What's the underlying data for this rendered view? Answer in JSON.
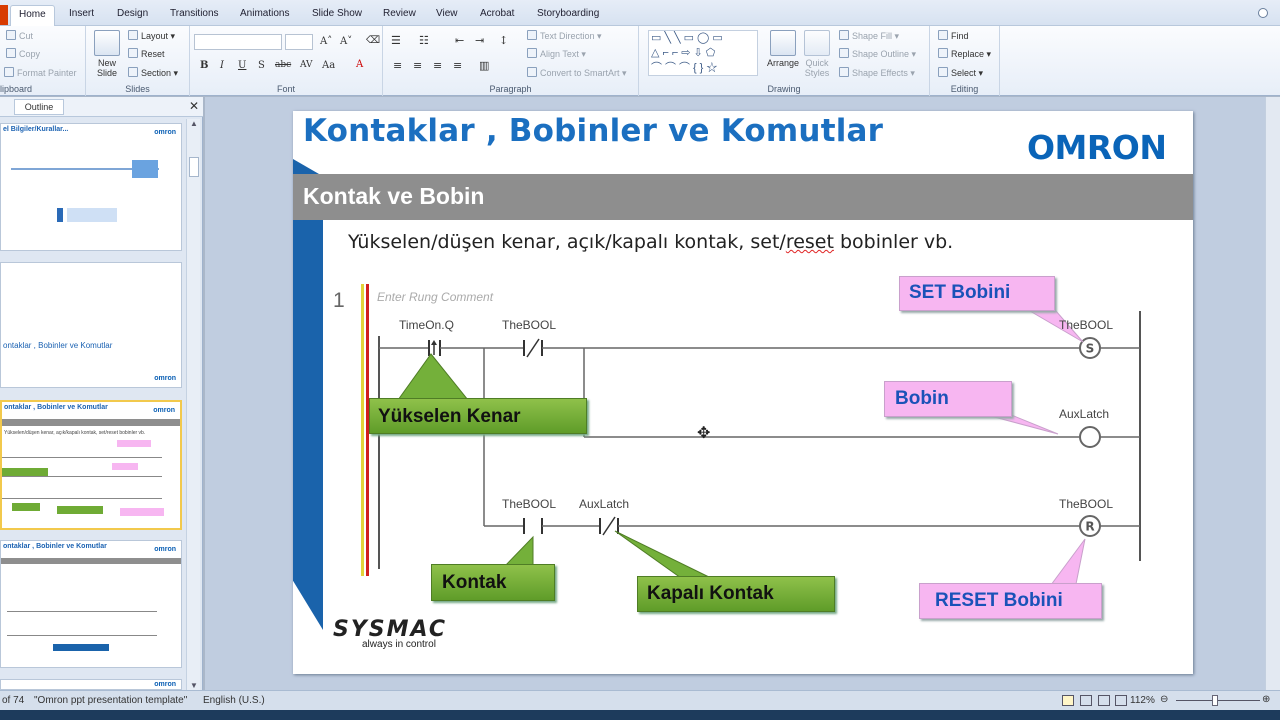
{
  "ribbon": {
    "tabs": [
      "Home",
      "Insert",
      "Design",
      "Transitions",
      "Animations",
      "Slide Show",
      "Review",
      "View",
      "Acrobat",
      "Storyboarding"
    ],
    "active_tab": "Home",
    "clipboard": {
      "cut": "Cut",
      "copy": "Copy",
      "format_painter": "Format Painter",
      "label": "lipboard"
    },
    "slides": {
      "new_slide": "New Slide",
      "layout": "Layout",
      "reset": "Reset",
      "section": "Section",
      "label": "Slides"
    },
    "font": {
      "label": "Font"
    },
    "paragraph": {
      "text_direction": "Text Direction",
      "align_text": "Align Text",
      "convert": "Convert to SmartArt",
      "label": "Paragraph"
    },
    "drawing": {
      "arrange": "Arrange",
      "quick_styles": "Quick Styles",
      "shape_fill": "Shape Fill",
      "shape_outline": "Shape Outline",
      "shape_effects": "Shape Effects",
      "label": "Drawing"
    },
    "editing": {
      "find": "Find",
      "replace": "Replace",
      "select": "Select",
      "label": "Editing"
    }
  },
  "left_panel": {
    "outline_tab": "Outline",
    "thumbs": [
      {
        "title": "el Bilgiler/Kurallar...",
        "logo": "omron"
      },
      {
        "title": "ontaklar ,  Bobinler ve Komutlar",
        "logo": "omron"
      },
      {
        "title": "ontaklar , Bobinler ve Komutlar",
        "logo": "omron",
        "sub": "Yükselen/düşen kenar, açık/kapalı kontak, set/reset bobinler vb."
      },
      {
        "title": "ontaklar , Bobinler ve Komutlar",
        "logo": "omron"
      },
      {
        "logo": "omron"
      }
    ]
  },
  "slide": {
    "title": "Kontaklar , Bobinler ve Komutlar",
    "logo": "OMRON",
    "subtitle": "Kontak ve Bobin",
    "body_before": "Yükselen/düşen kenar, açık/kapalı kontak, set/",
    "body_squiggle": "reset",
    "body_after": " bobinler vb.",
    "footer_logo": "SYSMAC",
    "footer_tag": "always in control",
    "ladder": {
      "rung_number": "1",
      "rung_comment": "Enter Rung Comment",
      "labels": {
        "timeon": "TimeOn.Q",
        "thebool1": "TheBOOL",
        "thebool_set": "TheBOOL",
        "auxlatch_coil": "AuxLatch",
        "thebool3": "TheBOOL",
        "auxlatch_contact": "AuxLatch",
        "thebool_reset": "TheBOOL"
      },
      "coil_s": "S",
      "coil_r": "R"
    },
    "callouts": {
      "set": "SET Bobini",
      "bobin": "Bobin",
      "rising": "Yükselen Kenar",
      "kontak": "Kontak",
      "kapali": "Kapalı Kontak",
      "reset": "RESET Bobini"
    },
    "colors": {
      "title_blue": "#1b6fc0",
      "omron_blue": "#0a64b8",
      "pink": "#f7b6f1",
      "green": "#6fab35",
      "grey_bar": "#8e8e8e"
    }
  },
  "status": {
    "slide_count": "of 74",
    "theme": "\"Omron ppt presentation template\"",
    "language": "English (U.S.)",
    "zoom": "112%",
    "zoom_level_percent": 112
  }
}
